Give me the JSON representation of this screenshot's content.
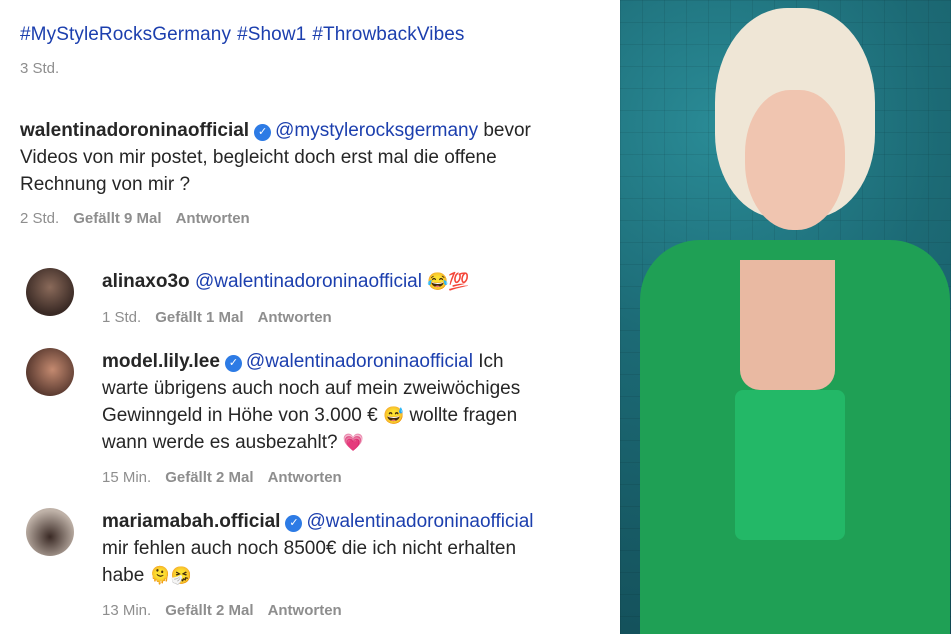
{
  "post": {
    "hashtags": [
      "#MyStyleRocksGermany",
      "#Show1",
      "#ThrowbackVibes"
    ],
    "time": "3 Std."
  },
  "comments": [
    {
      "username": "walentinadoroninaofficial",
      "mention": "@mystylerocksgermany",
      "text_after_mention": "bevor",
      "line2": "Videos von mir postet, begleicht doch erst mal die offene",
      "line3": "Rechnung von mir ?",
      "time": "2 Std.",
      "likes": "Gefällt 9 Mal",
      "reply": "Antworten"
    },
    {
      "username": "alinaxo3o",
      "mention": "@walentinadoroninaofficial",
      "emoji": "😂💯",
      "time": "1 Std.",
      "likes": "Gefällt 1 Mal",
      "reply": "Antworten"
    },
    {
      "username": "model.lily.lee",
      "mention": "@walentinadoroninaofficial",
      "text_after_mention": "Ich",
      "line2": "warte übrigens auch noch auf mein zweiwöchiges",
      "line3": "Gewinngeld in Höhe von 3.000 €",
      "line3_emoji": "😅",
      "line3_after": "wollte fragen",
      "line4": "wann werde es ausbezahlt?",
      "line4_emoji": "💗",
      "time": "15 Min.",
      "likes": "Gefällt 2 Mal",
      "reply": "Antworten"
    },
    {
      "username": "mariamabah.official",
      "mention": "@walentinadoroninaofficial",
      "line2": "mir fehlen auch noch 8500€ die ich nicht erhalten",
      "line3": "habe",
      "line3_emoji": "🫠🤧",
      "time": "13 Min.",
      "likes": "Gefällt 2 Mal",
      "reply": "Antworten"
    }
  ],
  "colors": {
    "link": "#1c3fae",
    "meta": "#8e8e8e",
    "verified": "#2d7be5",
    "text": "#262626"
  }
}
